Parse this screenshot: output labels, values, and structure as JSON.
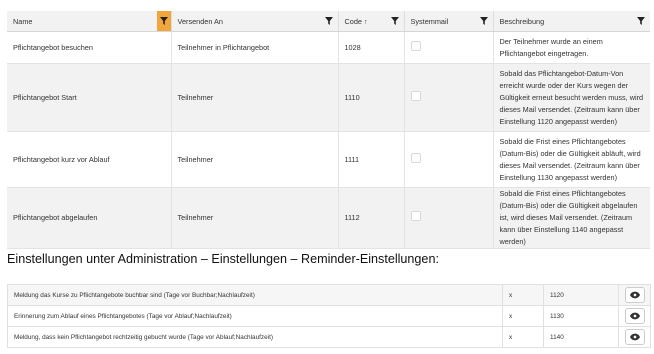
{
  "grid": {
    "headers": {
      "name": "Name",
      "sent_to": "Versenden An",
      "code": "Code",
      "code_sort": "↑",
      "systemmail": "Systemmail",
      "description": "Beschreibung"
    },
    "rows": [
      {
        "name": "Pflichtangebot besuchen",
        "sent_to": "Teilnehmer in Pflichtangebot",
        "code": "1028",
        "systemmail": false,
        "description": "Der Teilnehmer wurde an einem Pflichtangebot eingetragen."
      },
      {
        "name": "Pflichtangebot Start",
        "sent_to": "Teilnehmer",
        "code": "1110",
        "systemmail": false,
        "description": "Sobald das Pflichtangebot-Datum-Von erreicht wurde oder der Kurs wegen der Gültigkeit erneut besucht werden muss, wird dieses Mail versendet. (Zeitraum kann über Einstellung 1120 angepasst werden)"
      },
      {
        "name": "Pflichtangebot kurz vor Ablauf",
        "sent_to": "Teilnehmer",
        "code": "1111",
        "systemmail": false,
        "description": "Sobald die Frist eines Pflichtangebotes (Datum-Bis) oder die Gültigkeit abläuft, wird dieses Mail versendet. (Zeitraum kann über Einstellung 1130 angepasst werden)"
      },
      {
        "name": "Pflichtangebot abgelaufen",
        "sent_to": "Teilnehmer",
        "code": "1112",
        "systemmail": false,
        "description": "Sobald die Frist eines Pflichtangebotes (Datum-Bis) oder die Gültigkeit abgelaufen ist, wird dieses Mail versendet. (Zeitraum kann über Einstellung 1140 angepasst werden)"
      }
    ]
  },
  "section_heading": "Einstellungen unter Administration – Einstellungen – Reminder-Einstellungen:",
  "settings": [
    {
      "label": "Meldung das Kurse zu Pflichtangebote buchbar sind (Tage vor Buchbar;Nachlaufzeit)",
      "value": "x",
      "code": "1120"
    },
    {
      "label": "Erinnerung zum Ablauf eines Pflichtangebotes (Tage vor Ablauf;Nachlaufzeit)",
      "value": "x",
      "code": "1130"
    },
    {
      "label": "Meldung, dass kein Pflichtangebot rechtzeitig gebucht wurde (Tage vor Ablauf;Nachlaufzeit)",
      "value": "x",
      "code": "1140"
    }
  ],
  "icons": {
    "filter": "filter-icon",
    "view": "eye-icon"
  },
  "colors": {
    "active_filter": "#f0a63a",
    "header_bg": "#f2f2f2"
  }
}
